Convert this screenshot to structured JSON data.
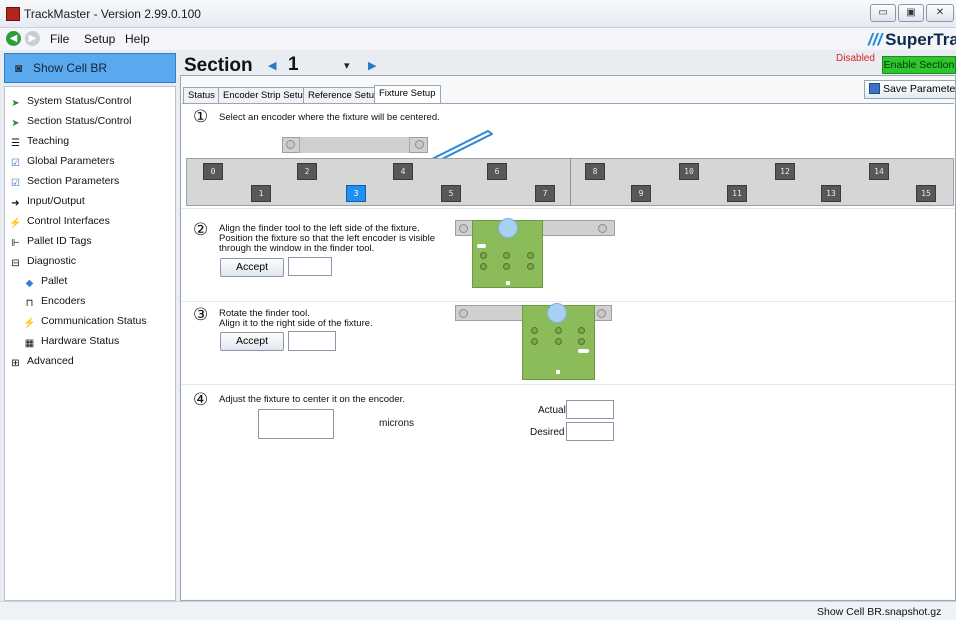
{
  "window": {
    "title": "TrackMaster - Version 2.99.0.100",
    "min_glyph": "▭",
    "max_glyph": "▣",
    "close_glyph": "✕"
  },
  "menu": {
    "back_glyph": "◀",
    "forward_glyph": "▶",
    "items": [
      "File",
      "Setup",
      "Help"
    ],
    "brand": "SuperTrak",
    "brand_slash": "///"
  },
  "sidebar": {
    "show_cell_button": "Show Cell BR",
    "items": [
      {
        "label": "System Status/Control",
        "icon": "status-arrow-icon"
      },
      {
        "label": "Section Status/Control",
        "icon": "status-arrow-icon"
      },
      {
        "label": "Teaching",
        "icon": "teaching-icon"
      },
      {
        "label": "Global Parameters",
        "icon": "checkbox-icon"
      },
      {
        "label": "Section Parameters",
        "icon": "checkbox-icon"
      },
      {
        "label": "Input/Output",
        "icon": "io-arrow-icon"
      },
      {
        "label": "Control Interfaces",
        "icon": "interface-icon"
      },
      {
        "label": "Pallet ID Tags",
        "icon": "tag-icon"
      },
      {
        "label": "Diagnostic",
        "icon": "collapse-minus-icon"
      },
      {
        "label": "Pallet",
        "icon": "pallet-icon"
      },
      {
        "label": "Encoders",
        "icon": "encoder-icon"
      },
      {
        "label": "Communication Status",
        "icon": "communication-icon"
      },
      {
        "label": "Hardware Status",
        "icon": "hardware-icon"
      },
      {
        "label": "Advanced",
        "icon": "expand-plus-icon"
      }
    ]
  },
  "section": {
    "label": "Section",
    "number": "1",
    "prev_glyph": "◀",
    "next_glyph": "▶",
    "dropdown_glyph": "▾",
    "status": "Disabled",
    "enable_button": "Enable Section",
    "save_button": "Save Parameters"
  },
  "tabs": [
    "Status",
    "Encoder Strip Setup",
    "Reference Setup",
    "Fixture Setup"
  ],
  "active_tab": "Fixture Setup",
  "steps": {
    "step1": {
      "num": "①",
      "text": "Select an encoder where the fixture will be centered."
    },
    "step2": {
      "num": "②",
      "line1": "Align the finder tool to the left side of the fixture.",
      "line2": "Position the fixture so that the left encoder is visible",
      "line3": "through the window in the finder tool.",
      "accept": "Accept",
      "value": ""
    },
    "step3": {
      "num": "③",
      "line1": "Rotate the finder tool.",
      "line2": "Align it to the right side of the fixture.",
      "accept": "Accept",
      "value": ""
    },
    "step4": {
      "num": "④",
      "text": "Adjust the fixture to center it on the encoder.",
      "unit": "microns",
      "actual_label": "Actual",
      "desired_label": "Desired",
      "adjust_value": "",
      "actual_value": "",
      "desired_value": ""
    }
  },
  "encoders": {
    "top_row": [
      "0",
      "2",
      "4",
      "6",
      "8",
      "10",
      "12",
      "14"
    ],
    "bottom_row": [
      "1",
      "3",
      "5",
      "7",
      "9",
      "11",
      "13",
      "15"
    ],
    "selected": "3"
  },
  "colors": {
    "selected_encoder": "#1f8ff0",
    "fixture": "#8cbb59",
    "enable_button": "#2ec52e",
    "disabled_text": "#dd2222",
    "show_cell_button": "#5aa9ee"
  },
  "statusbar": {
    "text": "Show Cell BR.snapshot.gz"
  }
}
